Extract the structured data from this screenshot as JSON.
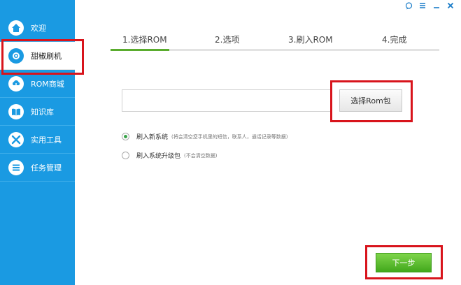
{
  "window": {
    "controls": {
      "feedback": "feedback-icon",
      "menu": "menu-icon",
      "minimize": "minimize-icon",
      "close": "close-icon"
    }
  },
  "sidebar": {
    "items": [
      {
        "label": "欢迎",
        "icon": "home-icon"
      },
      {
        "label": "甜椒刷机",
        "icon": "flash-icon",
        "active": true
      },
      {
        "label": "ROM商城",
        "icon": "cloud-download-icon"
      },
      {
        "label": "知识库",
        "icon": "book-icon"
      },
      {
        "label": "实用工具",
        "icon": "tools-icon"
      },
      {
        "label": "任务管理",
        "icon": "list-icon"
      }
    ]
  },
  "steps": [
    {
      "label": "1.选择ROM",
      "active": true
    },
    {
      "label": "2.选项"
    },
    {
      "label": "3.刷入ROM"
    },
    {
      "label": "4.完成"
    }
  ],
  "rom": {
    "value": "",
    "placeholder": "",
    "choose_label": "选择Rom包"
  },
  "options": [
    {
      "label": "刷入新系统",
      "hint": "(将会清空您手机里的短信，联系人，通话记录等数据)",
      "selected": true
    },
    {
      "label": "刷入系统升级包",
      "hint": "(不会清空数据)",
      "selected": false
    }
  ],
  "next_label": "下一步",
  "colors": {
    "sidebar": "#1a9ae2",
    "accent_green": "#5aac2e",
    "highlight_red": "#d8141c"
  }
}
